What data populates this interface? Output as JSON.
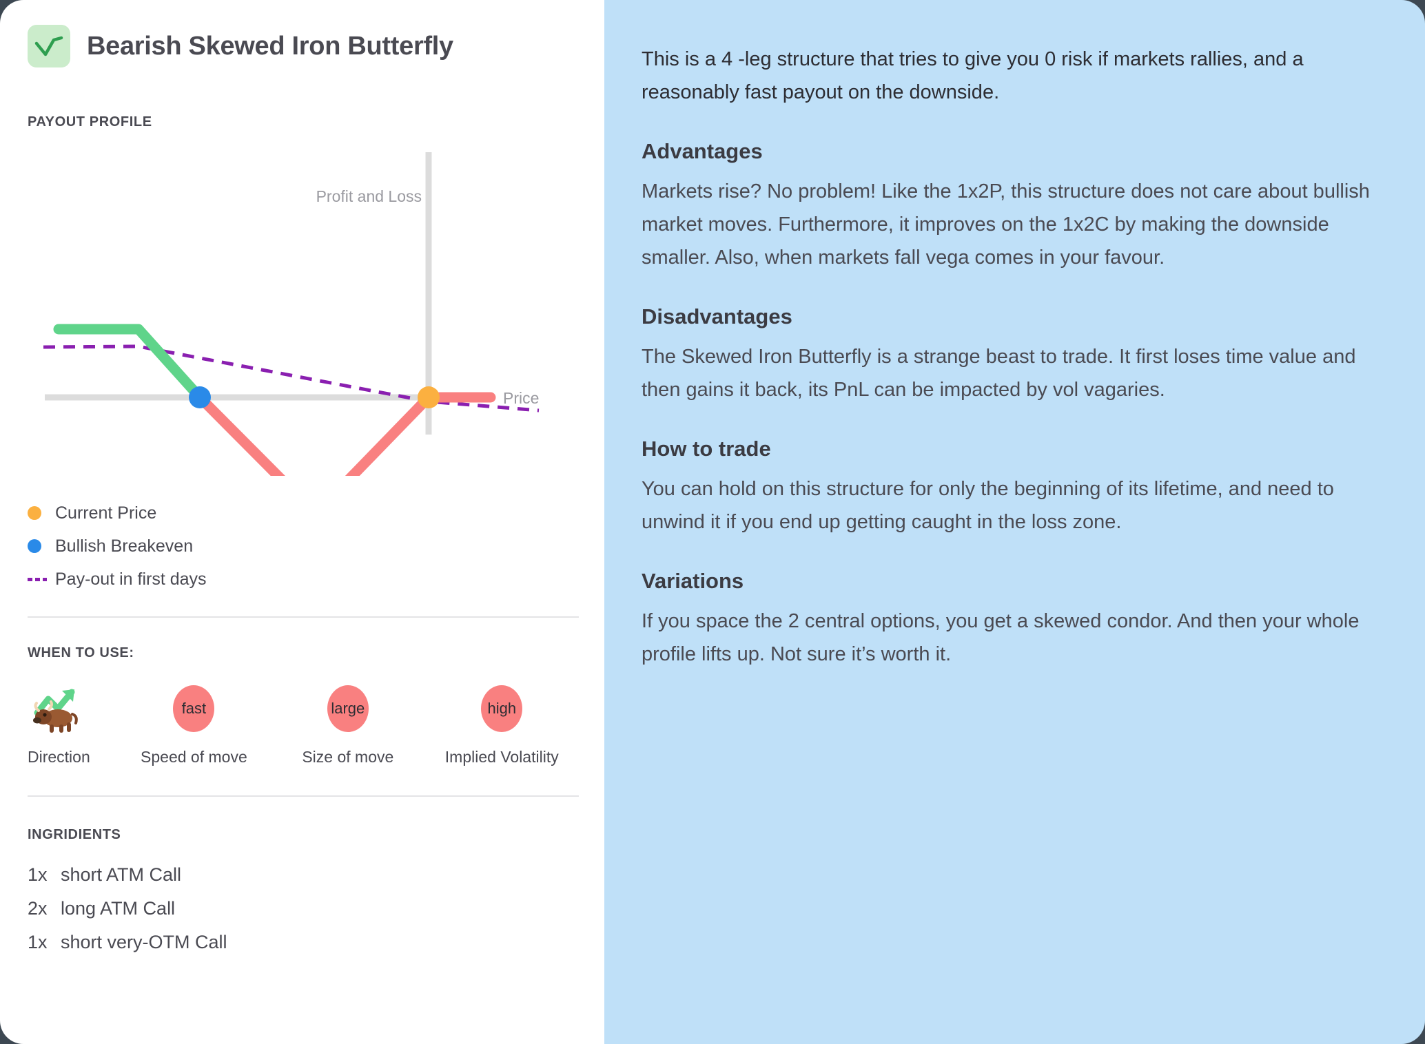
{
  "header": {
    "title": "Bearish Skewed Iron Butterfly",
    "icon": "payout-profile-check-icon",
    "icon_bg": "#cbeccb",
    "icon_stroke": "#2e9e4f"
  },
  "sections": {
    "payout_profile_label": "PAYOUT PROFILE",
    "when_to_use_label": "WHEN TO USE:",
    "ingridients_label": "INGRIDIENTS"
  },
  "chart_data": {
    "type": "line",
    "title": "",
    "xlabel": "Price",
    "ylabel": "Profit and Loss",
    "axis_labels": {
      "y": "Profit and Loss",
      "x": "Price"
    },
    "grid": false,
    "xlim": [
      0,
      877
    ],
    "ylim": [
      0,
      480
    ],
    "axes": {
      "y_axis_x": 622,
      "x_axis_y": 481,
      "axis_color": "#dcdcdc",
      "axis_thickness": 9
    },
    "series": [
      {
        "name": "Payout at expiry - profit zone",
        "color": "#5fd48a",
        "type": "line",
        "width": 14,
        "points": [
          [
            85,
            382
          ],
          [
            201,
            382
          ],
          [
            290,
            481
          ]
        ]
      },
      {
        "name": "Payout at expiry - loss zone",
        "color": "#f98080",
        "type": "line",
        "width": 14,
        "points": [
          [
            290,
            481
          ],
          [
            458,
            650
          ],
          [
            622,
            481
          ],
          [
            712,
            481
          ]
        ]
      },
      {
        "name": "Pay-out in first days",
        "color": "#8a1fb0",
        "type": "dashed-line",
        "width": 5,
        "points": [
          [
            63,
            408
          ],
          [
            200,
            407
          ],
          [
            622,
            487
          ],
          [
            780,
            500
          ]
        ]
      }
    ],
    "markers": [
      {
        "name": "Current Price",
        "color": "#fbb040",
        "x": 622,
        "y": 481,
        "r": 16
      },
      {
        "name": "Bullish Breakeven",
        "color": "#2a8ae8",
        "x": 290,
        "y": 481,
        "r": 16
      }
    ]
  },
  "legend": {
    "items": [
      {
        "label": "Current Price",
        "swatch": "dot",
        "color": "#fbb040"
      },
      {
        "label": "Bullish Breakeven",
        "swatch": "dot",
        "color": "#2a8ae8"
      },
      {
        "label": "Pay-out in first days",
        "swatch": "dash",
        "color": "#8a1fb0"
      }
    ]
  },
  "when_to_use": {
    "items": [
      {
        "caption": "Direction",
        "value": "",
        "graphic": "bull-with-up-arrow-icon"
      },
      {
        "caption": "Speed of move",
        "value": "fast",
        "graphic": "bubble"
      },
      {
        "caption": "Size of move",
        "value": "large",
        "graphic": "bubble"
      },
      {
        "caption": "Implied Volatility",
        "value": "high",
        "graphic": "bubble"
      }
    ],
    "bubble_color": "#f98080"
  },
  "ingridients": {
    "items": [
      {
        "qty": "1x",
        "name": "short ATM Call"
      },
      {
        "qty": "2x",
        "name": "long ATM Call"
      },
      {
        "qty": "1x",
        "name": "short very-OTM Call"
      }
    ]
  },
  "details": {
    "intro": "This is a 4 -leg  structure that tries to give you 0 risk if markets rallies, and a reasonably fast payout on the downside.",
    "blocks": [
      {
        "heading": "Advantages",
        "body": "Markets rise? No problem! Like the 1x2P, this structure does not care about bullish market moves. Furthermore, it improves on the 1x2C by making the downside smaller. Also, when markets fall vega comes in your favour."
      },
      {
        "heading": "Disadvantages",
        "body": "The Skewed Iron Butterfly is a strange beast to trade. It first loses time value and then gains it back, its PnL can be impacted by vol vagaries."
      },
      {
        "heading": "How to trade",
        "body": "You can hold on this structure for only the beginning of its lifetime, and need to unwind it if you end up getting caught in the loss zone."
      },
      {
        "heading": "Variations",
        "body": "If you space the 2 central options, you get a skewed condor. And then your whole profile lifts up. Not sure it’s worth it."
      }
    ]
  },
  "theme": {
    "page_background": "#3d4852",
    "left_card_bg": "#ffffff",
    "right_panel_bg": "#bfe0f8",
    "text_dark": "#4a4a52",
    "muted": "#9a9aa0"
  }
}
